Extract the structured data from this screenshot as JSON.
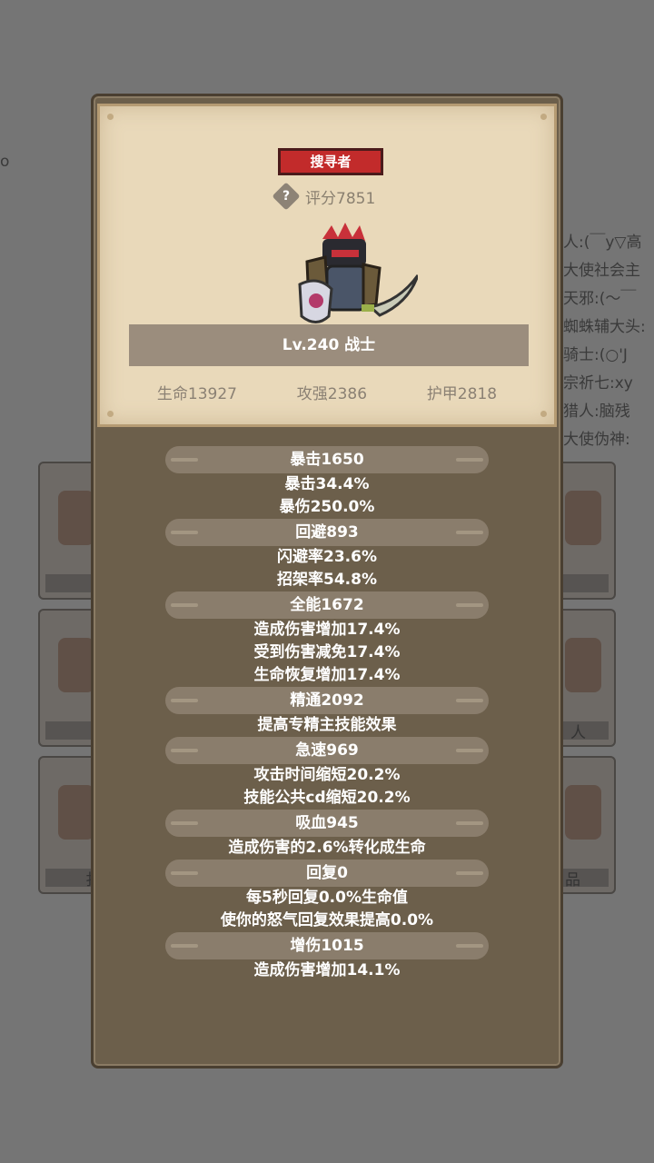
{
  "background": {
    "left_fragment": "o",
    "chat_lines": [
      "人:(￣y▽高",
      "大使社会主",
      "天邪:(～￣",
      "蜘蛛辅大头:",
      "骑士:(○'J",
      "宗祈七:xy",
      "猎人:脑残",
      "大使伪神:"
    ],
    "tile_labels": [
      "人",
      "扌",
      "品"
    ]
  },
  "header": {
    "tag": "搜寻者",
    "score": "评分7851",
    "level_class": "Lv.240 战士",
    "hp": "生命13927",
    "attack": "攻强2386",
    "armor": "护甲2818"
  },
  "attributes": [
    {
      "title": "暴击1650",
      "lines": [
        "暴击34.4%",
        "暴伤250.0%"
      ]
    },
    {
      "title": "回避893",
      "lines": [
        "闪避率23.6%",
        "招架率54.8%"
      ]
    },
    {
      "title": "全能1672",
      "lines": [
        "造成伤害增加17.4%",
        "受到伤害减免17.4%",
        "生命恢复增加17.4%"
      ]
    },
    {
      "title": "精通2092",
      "lines": [
        "提高专精主技能效果"
      ]
    },
    {
      "title": "急速969",
      "lines": [
        "攻击时间缩短20.2%",
        "技能公共cd缩短20.2%"
      ]
    },
    {
      "title": "吸血945",
      "lines": [
        "造成伤害的2.6%转化成生命"
      ]
    },
    {
      "title": "回复0",
      "lines": [
        "每5秒回复0.0%生命值",
        "使你的怒气回复效果提高0.0%"
      ]
    },
    {
      "title": "增伤1015",
      "lines": [
        "造成伤害增加14.1%"
      ]
    }
  ],
  "colors": {
    "tag_red": "#c22b2b",
    "paper": "#e9d9ba",
    "panel": "#6c5f4b",
    "pill": "#8a7d6c"
  }
}
